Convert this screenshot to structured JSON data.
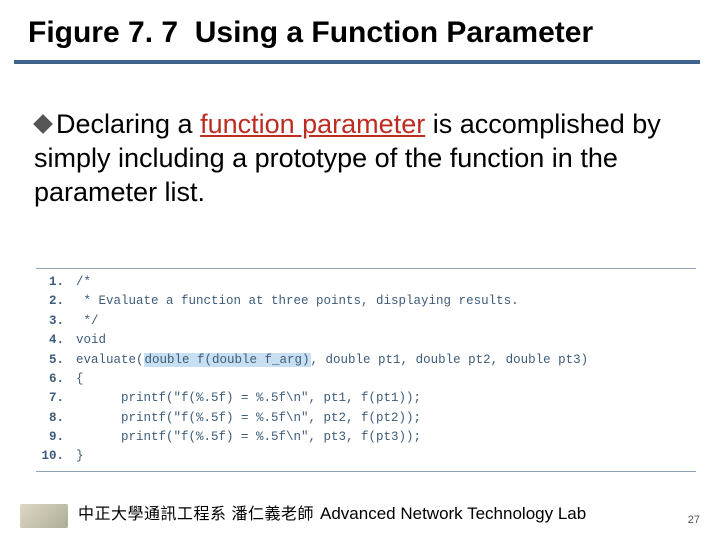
{
  "title_prefix": "Figure 7. 7",
  "title_rest": "Using a Function Parameter",
  "body": {
    "pre": "Declaring a ",
    "highlight": "function parameter",
    "post": " is accomplished by simply including a prototype of the function in the parameter list."
  },
  "code": {
    "lines": [
      {
        "n": "1.",
        "t": "/*"
      },
      {
        "n": "2.",
        "t": " * Evaluate a function at three points, displaying results."
      },
      {
        "n": "3.",
        "t": " */"
      },
      {
        "n": "4.",
        "t": "void"
      },
      {
        "n": "5.",
        "t": "evaluate(",
        "hl": "double f(double f_arg)",
        "t2": ", double pt1, double pt2, double pt3)"
      },
      {
        "n": "6.",
        "t": "{"
      },
      {
        "n": "7.",
        "t": "      printf(\"f(%.5f) = %.5f\\n\", pt1, f(pt1));"
      },
      {
        "n": "8.",
        "t": "      printf(\"f(%.5f) = %.5f\\n\", pt2, f(pt2));"
      },
      {
        "n": "9.",
        "t": "      printf(\"f(%.5f) = %.5f\\n\", pt3, f(pt3));"
      },
      {
        "n": "10.",
        "t": "}"
      }
    ]
  },
  "footer": {
    "cn": "中正大學通訊工程系 潘仁義老師",
    "en": "Advanced Network Technology Lab"
  },
  "page_num": "27"
}
